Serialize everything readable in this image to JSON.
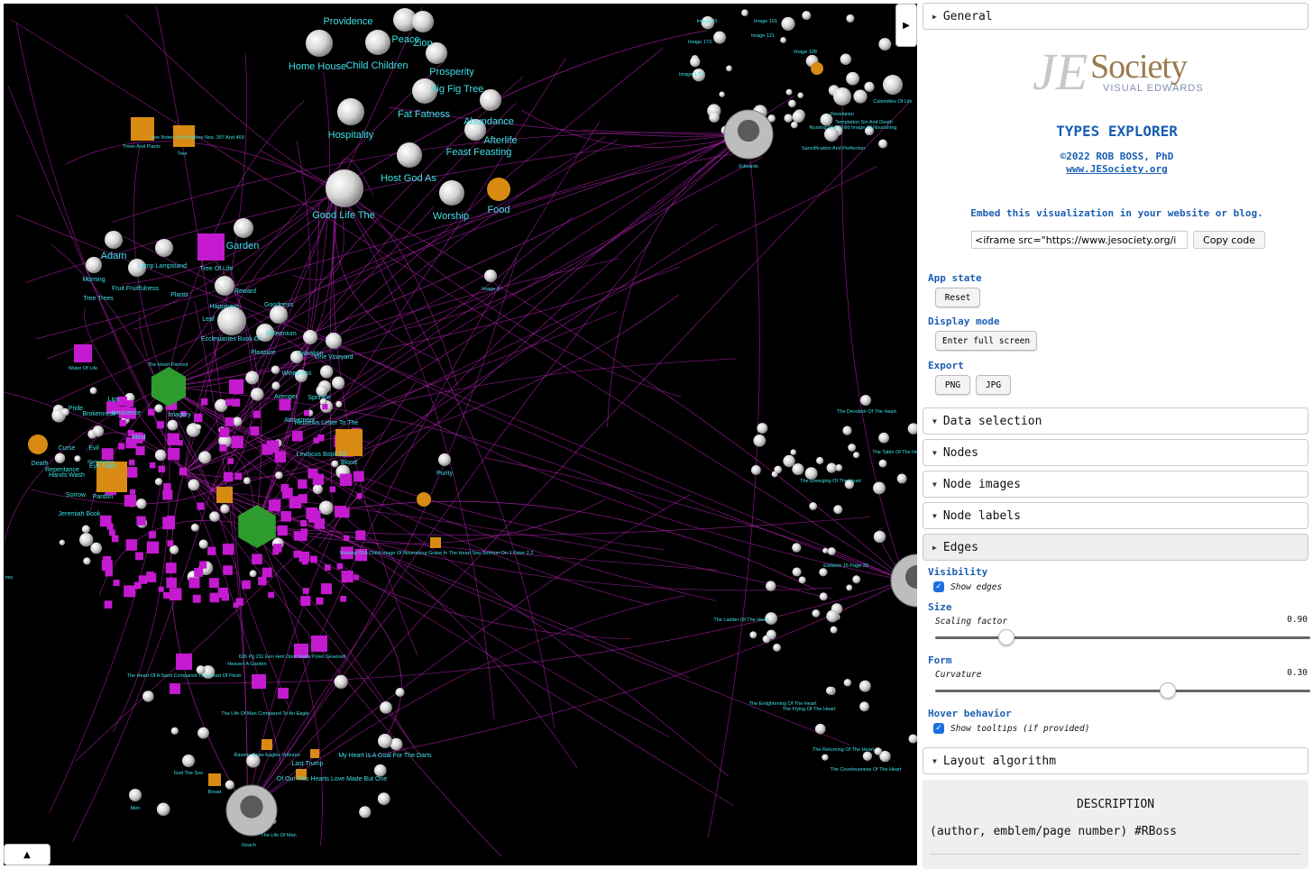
{
  "panel": {
    "sections": {
      "general": "General",
      "data_selection": "Data selection",
      "nodes": "Nodes",
      "node_images": "Node images",
      "node_labels": "Node labels",
      "edges": "Edges",
      "layout_algorithm": "Layout algorithm"
    },
    "logo": {
      "mark": "JE",
      "name": "Society",
      "sub": "VISUAL EDWARDS"
    },
    "app_title": "TYPES EXPLORER",
    "copyright": "©2022 ROB BOSS, PhD",
    "website": "www.JESociety.org",
    "embed_text": "Embed this visualization in your website or blog.",
    "embed_code": "<iframe src=\"https://www.jesociety.org/i",
    "copy_code": "Copy code",
    "app_state": {
      "label": "App state",
      "reset": "Reset"
    },
    "display_mode": {
      "label": "Display mode",
      "fullscreen": "Enter full screen"
    },
    "export": {
      "label": "Export",
      "png": "PNG",
      "jpg": "JPG"
    },
    "visibility": {
      "label": "Visibility",
      "show_edges": "Show edges"
    },
    "size": {
      "label": "Size",
      "scaling_factor": "Scaling factor",
      "scaling_value": "0.90",
      "scaling_fraction": 0.19
    },
    "form": {
      "label": "Form",
      "curvature": "Curvature",
      "curvature_value": "0.30",
      "curvature_fraction": 0.62
    },
    "hover": {
      "label": "Hover behavior",
      "show_tooltips": "Show tooltips (if provided)"
    },
    "description": {
      "title": "DESCRIPTION",
      "text": "(author, emblem/page number) #RBoss"
    }
  },
  "controls": {
    "side_toggle": "▶",
    "bottom_toggle": "▲"
  },
  "graph": {
    "colors": {
      "edge": "#b21fb0",
      "label": "#3fe0e6",
      "node_gray": "#d4d4d4",
      "node_magenta": "#c41ad0",
      "node_orange": "#d88a12",
      "node_green": "#2e9b2e"
    },
    "labels_large": [
      "Providence",
      "Peace",
      "Zion",
      "Home House",
      "Child Children",
      "Prosperity",
      "Fig Fig Tree",
      "Fat Fatness",
      "Abundance",
      "Hospitality",
      "Afterlife",
      "Feast Feasting",
      "Host God As",
      "Good Life The",
      "Worship",
      "Food",
      "Garden",
      "Adam"
    ],
    "labels_medium": [
      "Lamp Lampstand",
      "Tree Of Life",
      "Morning",
      "Fruit Fruitfulness",
      "Plants",
      "Tree Trees",
      "Reward",
      "Goodness",
      "Happiness",
      "Leaf",
      "Ecclesiastes Book Of",
      "Millennium",
      "Pleasure",
      "Salvation",
      "Vine Vineyard",
      "Winepress",
      "Avenger",
      "Sprinkle",
      "Atonement",
      "Hebrews Letter To The",
      "Imagery",
      "Lips",
      "Brokenness",
      "Innocence",
      "Mind",
      "Pride",
      "Evil",
      "Death",
      "Repentance",
      "Hands Wash",
      "Eye Sight",
      "Sorrow",
      "Pardon",
      "Jeremiah Book",
      "Curse",
      "Leviticus Book Of",
      "Blood",
      "Purity",
      "Redemption",
      "Trees And Plants",
      "Tree",
      "Revelation",
      "Sanctification And Perfection",
      "Nursing Of A Child Image Of Nourishing",
      "Temptation Sin And Death",
      "Calamities Of Life",
      "Edwards",
      "My Heart Is A Goal For The Darts",
      "Of Our Two Hearts Love Made But One",
      "Last Trump",
      "Ravens Grow Eagles Vultures",
      "Bread",
      "Men",
      "Keach",
      "The Life Of Man",
      "God The Son",
      "Heaven A Garden",
      "626 Pg 211 Een Hert Door Veele Pylen Gewondt",
      "The Heart Of A Saint Compared To A Heart Of Flesh",
      "The Life Of Man Compared To An Eagle",
      "Water Of Life",
      "The Heart Pierced",
      "The Devotion Of The Heart",
      "The Table Of The Heart",
      "The Emerging Of The Heart",
      "The Ladder Of The Heart",
      "The Enlightening Of The Heart",
      "The Flying Of The Heart",
      "The Returning Of The Heart",
      "The Covetousness Of The Heart",
      "Emblem 15 Page 39",
      "Image 6",
      "Image 101",
      "Image 121",
      "Image 20",
      "Image 125",
      "Image 108",
      "Image 173",
      "Nursing Of A Child Image Of Nourishing Grace In The Heart See Sermon On 1 Peter 2.2",
      "See Notes On Scripture Nos. 397 And 469",
      "ney"
    ]
  }
}
